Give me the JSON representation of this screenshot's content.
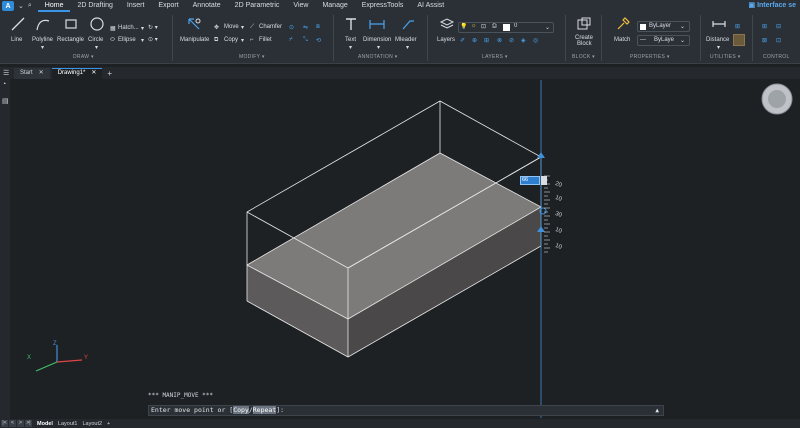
{
  "menu": {
    "logo_letter": "A",
    "tabs": [
      "Home",
      "2D Drafting",
      "Insert",
      "Export",
      "Annotate",
      "2D Parametric",
      "View",
      "Manage",
      "ExpressTools",
      "AI Assist"
    ],
    "active_tab": "Home",
    "interface_label": "Interface se"
  },
  "ribbon": {
    "draw": {
      "line": "Line",
      "polyline": "Polyline",
      "rectangle": "Rectangle",
      "circle": "Circle",
      "hatch": "Hatch...",
      "ellipse": "Ellipse",
      "title": "DRAW"
    },
    "modify": {
      "manipulate": "Manipulate",
      "move": "Move",
      "copy": "Copy",
      "chamfer": "Chamfer",
      "fillet": "Fillet",
      "title": "MODIFY"
    },
    "annotation": {
      "text": "Text",
      "dimension": "Dimension",
      "mleader": "Mleader",
      "title": "ANNOTATION"
    },
    "layers": {
      "layers": "Layers",
      "current_layer": "0",
      "title": "LAYERS"
    },
    "block": {
      "create_block_1": "Create",
      "create_block_2": "Block",
      "title": "BLOCK"
    },
    "properties": {
      "match": "Match",
      "color": "ByLayer",
      "linetype": "ByLaye",
      "title": "PROPERTIES"
    },
    "utilities": {
      "distance": "Distance",
      "title": "UTILITIES"
    },
    "control": {
      "title": "CONTROL"
    }
  },
  "doc_tabs": [
    {
      "label": "Start",
      "active": false
    },
    {
      "label": "Drawing1*",
      "active": true
    }
  ],
  "canvas": {
    "ruler_labels": [
      "20",
      "10",
      "30",
      "10",
      "10"
    ],
    "dimension_value": "66",
    "axis_labels": {
      "x": "X",
      "y": "Y",
      "z": "Z"
    }
  },
  "command": {
    "history": "*** MANIP_MOVE ***",
    "prompt_prefix": "Enter move point or [",
    "option_copy": "Copy",
    "slash": "/",
    "option_repeat": "Repeat",
    "prompt_suffix": "]:"
  },
  "status": {
    "nav": [
      "|<",
      "<",
      ">",
      ">|"
    ],
    "layouts": [
      "Model",
      "Layout1",
      "Layout2"
    ],
    "active_layout": "Model",
    "add": "+"
  }
}
